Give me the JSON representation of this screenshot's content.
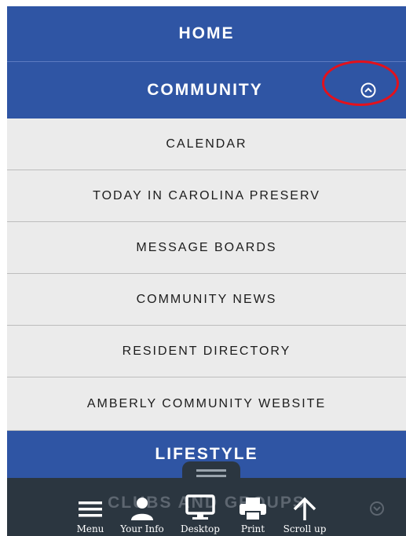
{
  "nav": {
    "home": "HOME",
    "community": "COMMUNITY",
    "community_items": [
      "CALENDAR",
      "TODAY IN CAROLINA PRESERV",
      "MESSAGE BOARDS",
      "COMMUNITY NEWS",
      "RESIDENT DIRECTORY",
      "AMBERLY COMMUNITY WEBSITE"
    ],
    "lifestyle": "LIFESTYLE",
    "clubs": "CLUBS AND GROUPS"
  },
  "toolbar": {
    "menu": "Menu",
    "your_info": "Your Info",
    "desktop": "Desktop",
    "print": "Print",
    "scroll_up": "Scroll up"
  },
  "colors": {
    "nav_blue": "#2f55a4",
    "submenu_bg": "#ebebeb",
    "toolbar_bg": "#2b3640",
    "annotation": "#e4111b"
  }
}
